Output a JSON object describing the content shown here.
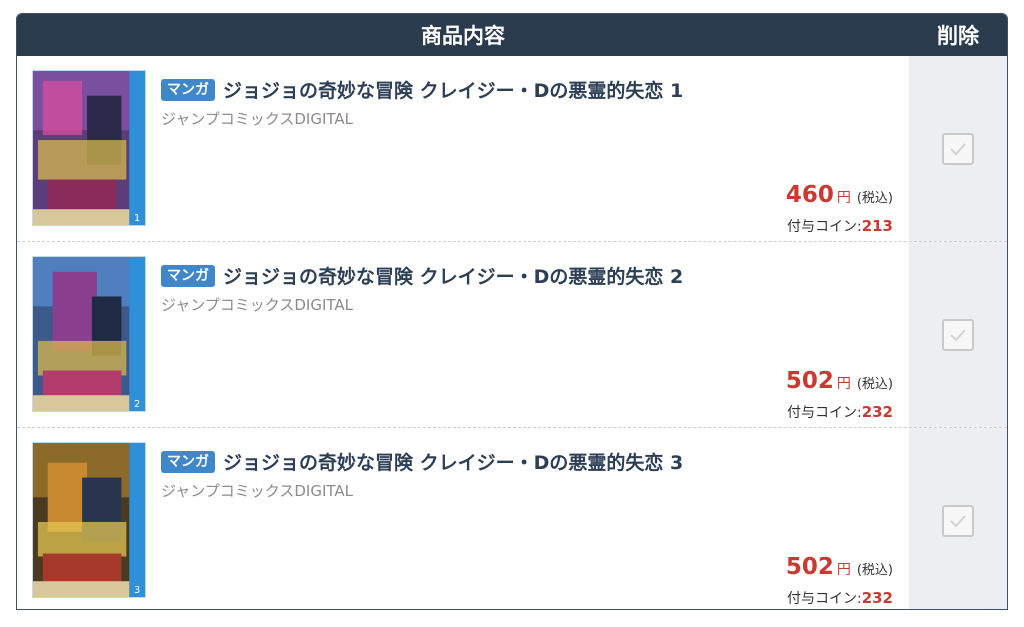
{
  "header": {
    "content_label": "商品内容",
    "delete_label": "削除"
  },
  "items": [
    {
      "badge": "マンガ",
      "title": "ジョジョの奇妙な冒険 クレイジー・Dの悪霊的失恋 1",
      "publisher": "ジャンプコミックスDIGITAL",
      "price": "460",
      "yen": "円",
      "tax": "(税込)",
      "coin_label": "付与コイン:",
      "coin_value": "213",
      "cover_volume": "1"
    },
    {
      "badge": "マンガ",
      "title": "ジョジョの奇妙な冒険 クレイジー・Dの悪霊的失恋 2",
      "publisher": "ジャンプコミックスDIGITAL",
      "price": "502",
      "yen": "円",
      "tax": "(税込)",
      "coin_label": "付与コイン:",
      "coin_value": "232",
      "cover_volume": "2"
    },
    {
      "badge": "マンガ",
      "title": "ジョジョの奇妙な冒険 クレイジー・Dの悪霊的失恋 3",
      "publisher": "ジャンプコミックスDIGITAL",
      "price": "502",
      "yen": "円",
      "tax": "(税込)",
      "coin_label": "付与コイン:",
      "coin_value": "232",
      "cover_volume": "3"
    }
  ],
  "colors": {
    "header_bg": "#2b3b4e",
    "badge_bg": "#3f87c9",
    "price": "#c73b32",
    "delete_column_bg": "#eceef1"
  }
}
